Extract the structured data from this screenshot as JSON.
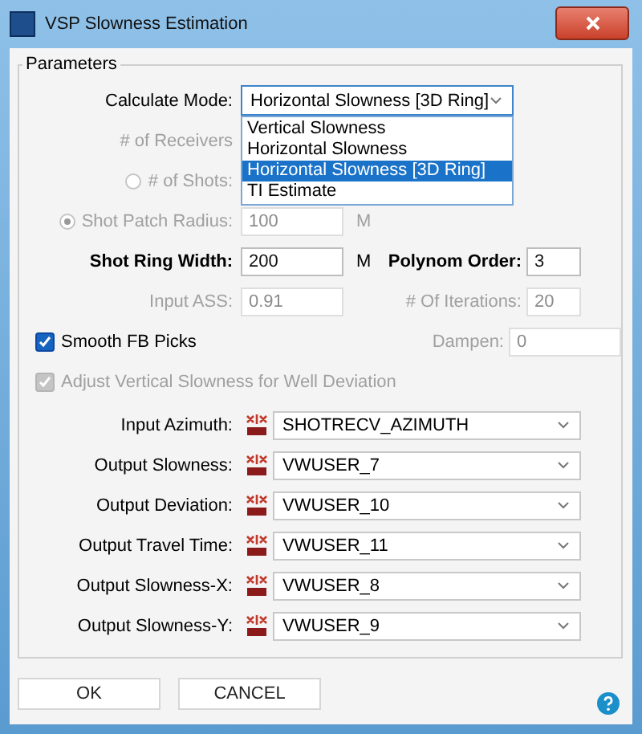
{
  "window": {
    "title": "VSP Slowness Estimation"
  },
  "group": {
    "title": "Parameters"
  },
  "calculate_mode": {
    "label": "Calculate Mode:",
    "value": "Horizontal Slowness [3D Ring]",
    "expanded": true,
    "options": [
      {
        "label": "Vertical Slowness",
        "selected": false
      },
      {
        "label": "Horizontal Slowness",
        "selected": false
      },
      {
        "label": "Horizontal Slowness [3D Ring]",
        "selected": true
      },
      {
        "label": "TI Estimate",
        "selected": false
      }
    ]
  },
  "receivers": {
    "label": "# of Receivers",
    "disabled": true
  },
  "shots": {
    "label": "# of Shots:",
    "selected": false,
    "disabled": true
  },
  "shot_patch_radius": {
    "label": "Shot Patch Radius:",
    "value": "100",
    "unit": "M",
    "selected": true,
    "disabled": true
  },
  "shot_ring_width": {
    "label": "Shot Ring Width:",
    "value": "200",
    "unit": "M",
    "disabled": false
  },
  "polynom_order": {
    "label": "Polynom Order:",
    "value": "3",
    "disabled": false
  },
  "input_ass": {
    "label": "Input ASS:",
    "value": "0.91",
    "disabled": true
  },
  "iterations": {
    "label": "# Of Iterations:",
    "value": "20",
    "disabled": true
  },
  "smooth_fb_picks": {
    "label": "Smooth FB Picks",
    "checked": true,
    "disabled": false
  },
  "dampen": {
    "label": "Dampen:",
    "value": "0",
    "disabled": true
  },
  "adjust_vertical": {
    "label": "Adjust Vertical Slowness for Well Deviation",
    "checked": true,
    "disabled": true
  },
  "headers": [
    {
      "label": "Input Azimuth:",
      "value": "SHOTRECV_AZIMUTH"
    },
    {
      "label": "Output Slowness:",
      "value": "VWUSER_7"
    },
    {
      "label": "Output Deviation:",
      "value": "VWUSER_10"
    },
    {
      "label": "Output Travel Time:",
      "value": "VWUSER_11"
    },
    {
      "label": "Output Slowness-X:",
      "value": "VWUSER_8"
    },
    {
      "label": "Output Slowness-Y:",
      "value": "VWUSER_9"
    }
  ],
  "buttons": [
    {
      "label": "OK"
    },
    {
      "label": "CANCEL"
    }
  ]
}
